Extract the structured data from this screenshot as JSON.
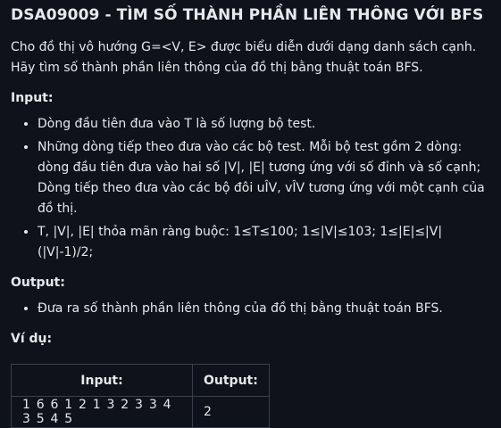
{
  "problem": {
    "title": "DSA09009 - TÌM SỐ THÀNH PHẦN LIÊN THÔNG VỚI BFS",
    "description": "Cho đồ thị vô hướng G=<V, E> được biểu diễn dưới dạng danh sách cạnh. Hãy tìm số thành phần liên thông của đồ thị bằng thuật toán BFS."
  },
  "input_section": {
    "heading": "Input:",
    "items": [
      "Dòng đầu tiên đưa vào T là số lượng bộ test.",
      "Những dòng tiếp theo đưa vào các bộ test. Mỗi bộ test gồm 2 dòng: dòng đầu tiên đưa vào hai số |V|, |E| tương ứng với số đỉnh và số cạnh; Dòng tiếp theo đưa vào các bộ đôi uÎV, vÎV tương ứng với một cạnh của đồ thị.",
      "T, |V|, |E| thỏa mãn ràng buộc: 1≤T≤100; 1≤|V|≤103; 1≤|E|≤|V|(|V|-1)/2;"
    ]
  },
  "output_section": {
    "heading": "Output:",
    "items": [
      "Đưa ra số thành phần liên thông của đồ thị bằng thuật toán BFS."
    ]
  },
  "example": {
    "heading": "Ví dụ:",
    "headers": [
      "Input:",
      "Output:"
    ],
    "rows": [
      [
        "1 6 6 1 2 1 3 2 3 3 4 3 5 4 5",
        "2"
      ]
    ]
  }
}
